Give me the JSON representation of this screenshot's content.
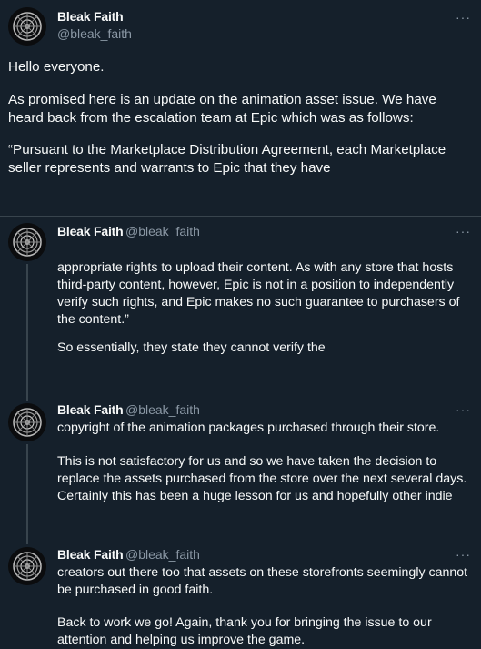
{
  "main_tweet": {
    "author_name": "Bleak Faith",
    "author_handle": "@bleak_faith",
    "more_label": "···",
    "paragraphs": [
      "Hello everyone.",
      "As promised here is an update on the animation asset issue. We have heard back from the escalation team at Epic which was as follows:",
      "“Pursuant to the Marketplace Distribution Agreement, each Marketplace seller represents and warrants to Epic that they have"
    ]
  },
  "replies": [
    {
      "author_name": "Bleak Faith",
      "author_handle": "@bleak_faith",
      "more_label": "···",
      "paragraphs": [
        "appropriate rights to upload their content. As with any store that hosts third-party content, however, Epic is not in a position to independently verify such rights, and Epic makes no such guarantee to purchasers of the content.”",
        "So essentially, they state they cannot verify the"
      ]
    },
    {
      "author_name": "Bleak Faith",
      "author_handle": "@bleak_faith",
      "more_label": "···",
      "paragraphs": [
        "copyright of the animation packages purchased through their store.",
        "This is not satisfactory for us and so we have taken the decision to replace the assets purchased from the store over the next several days. Certainly this has been a huge lesson for us and hopefully other indie"
      ]
    },
    {
      "author_name": "Bleak Faith",
      "author_handle": "@bleak_faith",
      "more_label": "···",
      "paragraphs": [
        "creators out there too that assets on these storefronts seemingly cannot be purchased in good faith.",
        "Back to work we go! Again, thank you for bringing the issue to our attention and helping us improve the game."
      ]
    }
  ],
  "colors": {
    "background": "#15202b",
    "text": "#f7f9f9",
    "secondary": "#8b98a5",
    "border": "#38444d"
  }
}
